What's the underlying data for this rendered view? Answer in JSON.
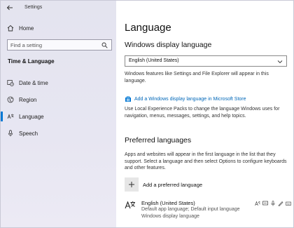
{
  "window": {
    "title": "Settings"
  },
  "sidebar": {
    "home_label": "Home",
    "search_placeholder": "Find a setting",
    "section_title": "Time & Language",
    "items": [
      {
        "label": "Date & time",
        "icon": "calendar-clock-icon"
      },
      {
        "label": "Region",
        "icon": "globe-icon"
      },
      {
        "label": "Language",
        "icon": "language-icon",
        "active": true
      },
      {
        "label": "Speech",
        "icon": "microphone-icon"
      }
    ]
  },
  "main": {
    "page_title": "Language",
    "display_language": {
      "heading": "Windows display language",
      "selected": "English (United States)",
      "description": "Windows features like Settings and File Explorer will appear in this language.",
      "store_link": "Add a Windows display language in Microsoft Store",
      "store_description": "Use Local Experience Packs to change the language Windows uses for navigation, menus, messages, settings, and help topics."
    },
    "preferred": {
      "heading": "Preferred languages",
      "description": "Apps and websites will appear in the first language in the list that they support. Select a language and then select Options to configure keyboards and other features.",
      "add_label": "Add a preferred language",
      "languages": [
        {
          "name": "English (United States)",
          "line1": "Default app language; Default input language",
          "line2": "Windows display language"
        }
      ]
    }
  },
  "colors": {
    "accent": "#0078d4",
    "link": "#0067b8",
    "sidebar_bg": "#e6e5f1"
  }
}
